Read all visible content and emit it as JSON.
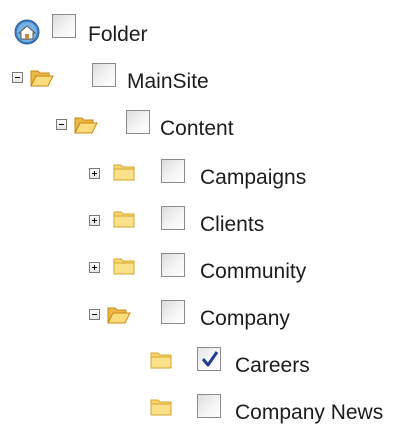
{
  "tree": {
    "root": {
      "label": "Folder",
      "checked": false
    },
    "mainsite": {
      "label": "MainSite",
      "expanded": true,
      "checked": false
    },
    "content": {
      "label": "Content",
      "expanded": true,
      "checked": false
    },
    "campaigns": {
      "label": "Campaigns",
      "expanded": false,
      "checked": false
    },
    "clients": {
      "label": "Clients",
      "expanded": false,
      "checked": false
    },
    "community": {
      "label": "Community",
      "expanded": false,
      "checked": false
    },
    "company": {
      "label": "Company",
      "expanded": true,
      "checked": false
    },
    "careers": {
      "label": "Careers",
      "checked": true
    },
    "company_news": {
      "label": "Company News",
      "checked": false
    }
  },
  "icons": {
    "root": "home-globe-icon",
    "folder_open": "folder-open-icon",
    "folder_closed": "folder-closed-icon",
    "expand": "plus-box-icon",
    "collapse": "minus-box-icon",
    "check": "checkmark-icon"
  },
  "colors": {
    "folder_body": "#f6d36a",
    "folder_edge": "#d79a1f",
    "checkmark": "#1f3f8f",
    "text": "#1c1c1c"
  }
}
